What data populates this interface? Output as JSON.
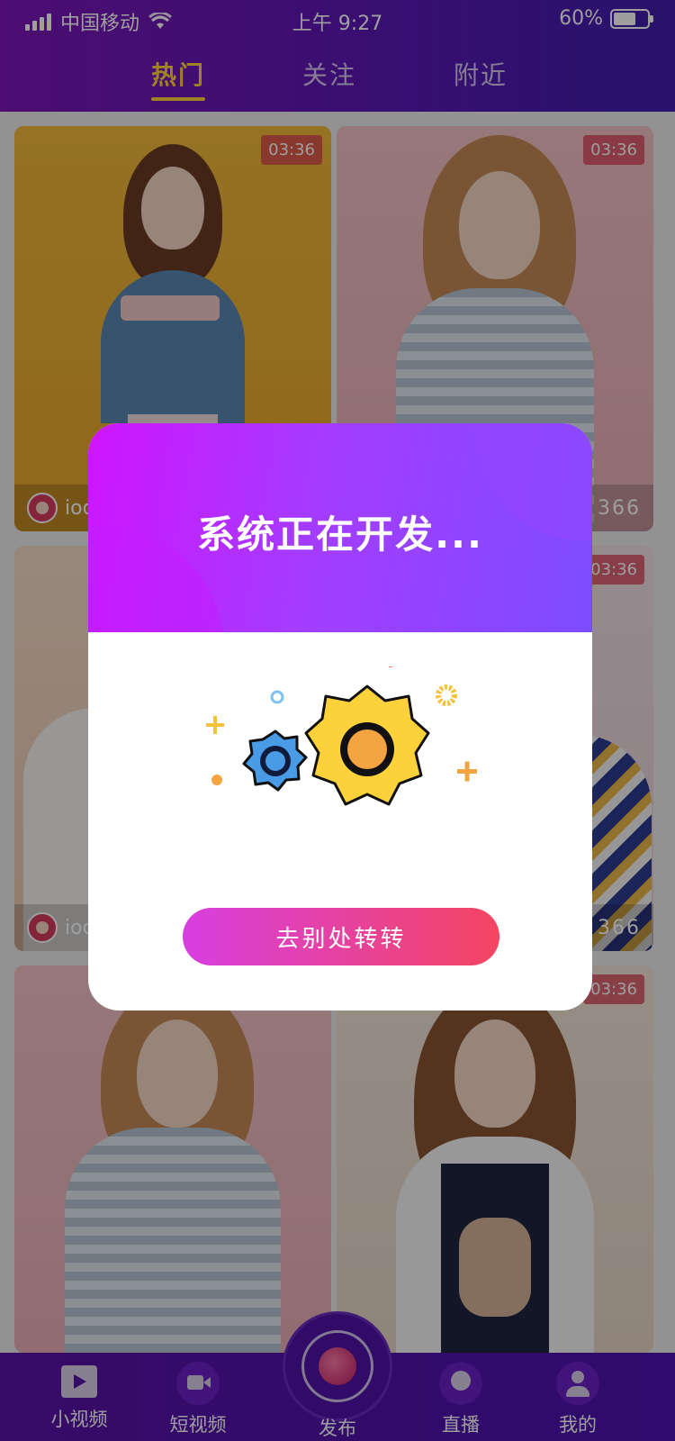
{
  "status_bar": {
    "carrier": "中国移动",
    "time": "上午 9:27",
    "battery": "60%",
    "battery_level": 0.6
  },
  "tabs": [
    {
      "label": "热门",
      "active": true
    },
    {
      "label": "关注",
      "active": false
    },
    {
      "label": "附近",
      "active": false
    }
  ],
  "cards": [
    {
      "duration": "03:36",
      "username": "ioo",
      "likes": ""
    },
    {
      "duration": "03:36",
      "username": "",
      "likes": "366"
    },
    {
      "duration": "",
      "username": "ioo",
      "likes": ""
    },
    {
      "duration": "03:36",
      "username": "",
      "likes": "366"
    },
    {
      "duration": "",
      "username": "",
      "likes": ""
    },
    {
      "duration": "03:36",
      "username": "",
      "likes": ""
    }
  ],
  "bottom_nav": {
    "small_video": "小视频",
    "short_video": "短视频",
    "publish": "发布",
    "live": "直播",
    "me": "我的"
  },
  "modal": {
    "title": "系统正在开发...",
    "button": "去别处转转"
  },
  "colors": {
    "header": "#6a17b6",
    "active_tab": "#ffd23a",
    "modal_gradient_start": "#cf14ff",
    "modal_gradient_end": "#7d4cff",
    "button_gradient_start": "#d73fe0",
    "button_gradient_end": "#f44560"
  }
}
